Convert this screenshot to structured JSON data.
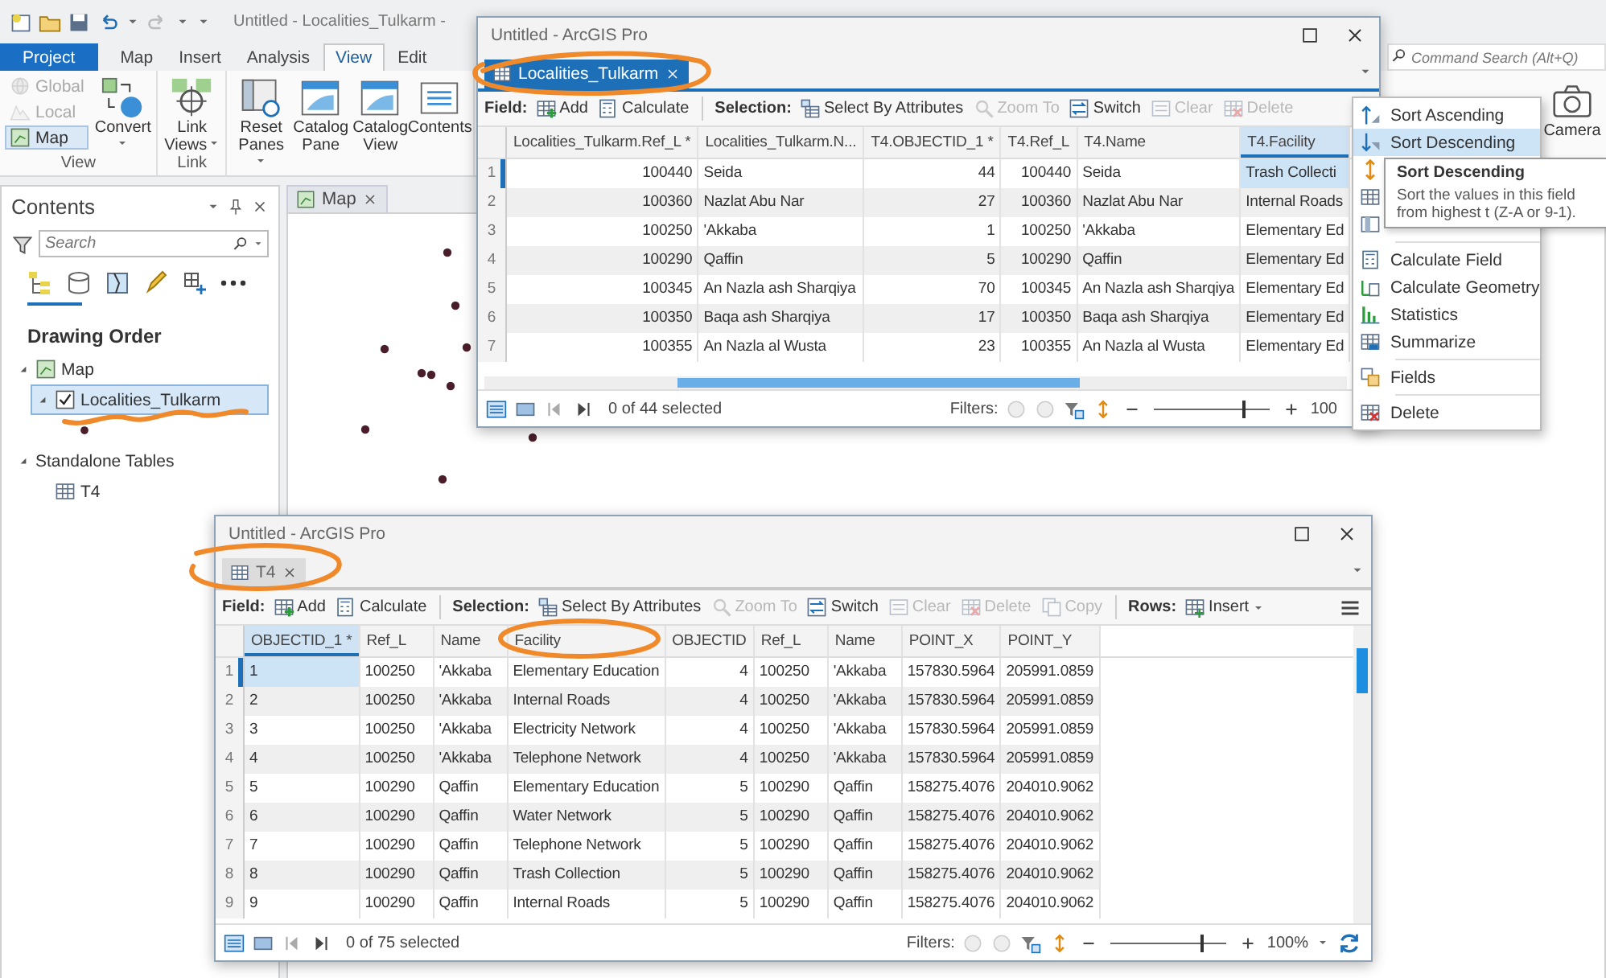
{
  "app": {
    "title": "Untitled - Localities_Tulkarm -",
    "ribbon_tabs": [
      {
        "label": "Project",
        "kind": "backstage",
        "selected": false
      },
      {
        "label": "Map",
        "kind": "tab",
        "selected": false
      },
      {
        "label": "Insert",
        "kind": "tab",
        "selected": false
      },
      {
        "label": "Analysis",
        "kind": "tab",
        "selected": false
      },
      {
        "label": "View",
        "kind": "tab",
        "selected": true
      },
      {
        "label": "Edit",
        "kind": "tab",
        "selected": false
      }
    ],
    "command_search": {
      "placeholder": "Command Search (Alt+Q)"
    },
    "ribbon_groups": [
      {
        "label": "View",
        "view_modes": [
          {
            "label": "Global",
            "selected": false,
            "disabled": true
          },
          {
            "label": "Local",
            "selected": false,
            "disabled": true
          },
          {
            "label": "Map",
            "selected": true,
            "disabled": false
          }
        ],
        "buttons": [
          {
            "label": "Convert",
            "dropdown": true
          }
        ]
      },
      {
        "label": "Link",
        "buttons": [
          {
            "label": "Link Views",
            "dropdown": true
          }
        ]
      },
      {
        "buttons": [
          {
            "label": "Reset Panes",
            "dropdown": true
          },
          {
            "label": "Catalog Pane",
            "dropdown": false
          },
          {
            "label": "Catalog View",
            "dropdown": false
          },
          {
            "label": "Contents",
            "dropdown": false
          }
        ]
      }
    ],
    "right_buttons": [
      {
        "label": "Camera"
      }
    ]
  },
  "contents": {
    "title": "Contents",
    "search": {
      "placeholder": "Search"
    },
    "heading": "Drawing Order",
    "tree": [
      {
        "label": "Map",
        "kind": "map",
        "expanded": true,
        "selected": false,
        "children": [
          {
            "label": "Localities_Tulkarm",
            "kind": "layer",
            "expanded": true,
            "checked": true,
            "selected": true,
            "children": [
              {
                "kind": "symbol"
              }
            ]
          }
        ]
      },
      {
        "label": "Standalone Tables",
        "kind": "group",
        "expanded": true,
        "selected": false,
        "children": [
          {
            "label": "T4",
            "kind": "table",
            "selected": false
          }
        ]
      }
    ]
  },
  "map_view": {
    "tab": "Map"
  },
  "windows": [
    {
      "title": "Untitled - ArcGIS Pro",
      "tab": {
        "label": "Localities_Tulkarm",
        "active": true
      },
      "toolbar": {
        "field_label": "Field:",
        "field_buttons": [
          {
            "label": "Add",
            "disabled": false
          },
          {
            "label": "Calculate",
            "disabled": false
          }
        ],
        "selection_label": "Selection:",
        "selection_buttons": [
          {
            "label": "Select By Attributes",
            "disabled": false
          },
          {
            "label": "Zoom To",
            "disabled": true
          },
          {
            "label": "Switch",
            "disabled": false
          },
          {
            "label": "Clear",
            "disabled": true
          },
          {
            "label": "Delete",
            "disabled": true
          }
        ]
      },
      "columns": [
        {
          "label": "Localities_Tulkarm.Ref_L *",
          "selected": false
        },
        {
          "label": "Localities_Tulkarm.N...",
          "selected": false
        },
        {
          "label": "T4.OBJECTID_1 *",
          "selected": false
        },
        {
          "label": "T4.Ref_L",
          "selected": false
        },
        {
          "label": "T4.Name",
          "selected": false
        },
        {
          "label": "T4.Facility",
          "selected": true
        }
      ],
      "rows": [
        {
          "number": "1",
          "current": true,
          "cells": [
            "100440",
            "Seida",
            "44",
            "100440",
            "Seida",
            "Trash Collecti"
          ]
        },
        {
          "number": "2",
          "current": false,
          "cells": [
            "100360",
            "Nazlat Abu Nar",
            "27",
            "100360",
            "Nazlat Abu Nar",
            "Internal Roads"
          ]
        },
        {
          "number": "3",
          "current": false,
          "cells": [
            "100250",
            "'Akkaba",
            "1",
            "100250",
            "'Akkaba",
            "Elementary Ed"
          ]
        },
        {
          "number": "4",
          "current": false,
          "cells": [
            "100290",
            "Qaffin",
            "5",
            "100290",
            "Qaffin",
            "Elementary Ed"
          ]
        },
        {
          "number": "5",
          "current": false,
          "cells": [
            "100345",
            "An Nazla ash Sharqiya",
            "70",
            "100345",
            "An Nazla ash Sharqiya",
            "Elementary Ed"
          ]
        },
        {
          "number": "6",
          "current": false,
          "cells": [
            "100350",
            "Baqa ash Sharqiya",
            "17",
            "100350",
            "Baqa ash Sharqiya",
            "Elementary Ed"
          ]
        },
        {
          "number": "7",
          "current": false,
          "cells": [
            "100355",
            "An Nazla al Wusta",
            "23",
            "100355",
            "An Nazla al Wusta",
            "Elementary Ed"
          ]
        }
      ],
      "status": {
        "count": "0 of 44 selected",
        "filters_label": "Filters:",
        "zoom_slider": {
          "level": 0.78
        },
        "zoom": "100"
      }
    },
    {
      "title": "Untitled - ArcGIS Pro",
      "tab": {
        "label": "T4",
        "active": false
      },
      "toolbar": {
        "field_label": "Field:",
        "field_buttons": [
          {
            "label": "Add",
            "disabled": false
          },
          {
            "label": "Calculate",
            "disabled": false
          }
        ],
        "selection_label": "Selection:",
        "selection_buttons": [
          {
            "label": "Select By Attributes",
            "disabled": false
          },
          {
            "label": "Zoom To",
            "disabled": true
          },
          {
            "label": "Switch",
            "disabled": false
          },
          {
            "label": "Clear",
            "disabled": true
          },
          {
            "label": "Delete",
            "disabled": true
          },
          {
            "label": "Copy",
            "disabled": true
          }
        ],
        "rows_label": "Rows:",
        "rows_buttons": [
          {
            "label": "Insert",
            "disabled": false
          }
        ]
      },
      "columns": [
        {
          "label": "OBJECTID_1 *",
          "selected": true
        },
        {
          "label": "Ref_L",
          "selected": false
        },
        {
          "label": "Name",
          "selected": false
        },
        {
          "label": "Facility",
          "selected": false
        },
        {
          "label": "OBJECTID",
          "selected": false
        },
        {
          "label": "Ref_L",
          "selected": false
        },
        {
          "label": "Name",
          "selected": false
        },
        {
          "label": "POINT_X",
          "selected": false
        },
        {
          "label": "POINT_Y",
          "selected": false
        }
      ],
      "rows": [
        {
          "number": "1",
          "current": true,
          "cells": [
            "1",
            "100250",
            "'Akkaba",
            "Elementary Education",
            "4",
            "100250",
            "'Akkaba",
            "157830.5964",
            "205991.0859"
          ]
        },
        {
          "number": "2",
          "current": false,
          "cells": [
            "2",
            "100250",
            "'Akkaba",
            "Internal Roads",
            "4",
            "100250",
            "'Akkaba",
            "157830.5964",
            "205991.0859"
          ]
        },
        {
          "number": "3",
          "current": false,
          "cells": [
            "3",
            "100250",
            "'Akkaba",
            "Electricity Network",
            "4",
            "100250",
            "'Akkaba",
            "157830.5964",
            "205991.0859"
          ]
        },
        {
          "number": "4",
          "current": false,
          "cells": [
            "4",
            "100250",
            "'Akkaba",
            "Telephone Network",
            "4",
            "100250",
            "'Akkaba",
            "157830.5964",
            "205991.0859"
          ]
        },
        {
          "number": "5",
          "current": false,
          "cells": [
            "5",
            "100290",
            "Qaffin",
            "Elementary Education",
            "5",
            "100290",
            "Qaffin",
            "158275.4076",
            "204010.9062"
          ]
        },
        {
          "number": "6",
          "current": false,
          "cells": [
            "6",
            "100290",
            "Qaffin",
            "Water Network",
            "5",
            "100290",
            "Qaffin",
            "158275.4076",
            "204010.9062"
          ]
        },
        {
          "number": "7",
          "current": false,
          "cells": [
            "7",
            "100290",
            "Qaffin",
            "Telephone Network",
            "5",
            "100290",
            "Qaffin",
            "158275.4076",
            "204010.9062"
          ]
        },
        {
          "number": "8",
          "current": false,
          "cells": [
            "8",
            "100290",
            "Qaffin",
            "Trash Collection",
            "5",
            "100290",
            "Qaffin",
            "158275.4076",
            "204010.9062"
          ]
        },
        {
          "number": "9",
          "current": false,
          "cells": [
            "9",
            "100290",
            "Qaffin",
            "Internal Roads",
            "5",
            "100290",
            "Qaffin",
            "158275.4076",
            "204010.9062"
          ]
        }
      ],
      "status": {
        "count": "0 of 75 selected",
        "filters_label": "Filters:",
        "zoom_slider": {
          "level": 0.78
        },
        "zoom": "100%",
        "zoom_menu": true
      }
    }
  ],
  "context_menu": {
    "items": [
      {
        "kind": "item",
        "label": "Sort Ascending",
        "selected": false
      },
      {
        "kind": "item",
        "label": "Sort Descending",
        "selected": true
      },
      {
        "kind": "covered"
      },
      {
        "kind": "covered"
      },
      {
        "kind": "covered"
      },
      {
        "kind": "separator"
      },
      {
        "kind": "item",
        "label": "Calculate Field",
        "selected": false
      },
      {
        "kind": "item",
        "label": "Calculate Geometry",
        "selected": false
      },
      {
        "kind": "item",
        "label": "Statistics",
        "selected": false
      },
      {
        "kind": "item",
        "label": "Summarize",
        "selected": false
      },
      {
        "kind": "separator"
      },
      {
        "kind": "item",
        "label": "Fields",
        "selected": false
      },
      {
        "kind": "separator"
      },
      {
        "kind": "item",
        "label": "Delete",
        "selected": false
      }
    ]
  },
  "tooltip": {
    "title": "Sort Descending",
    "text": "Sort the values in this field from highest t (Z-A or 9-1)."
  }
}
